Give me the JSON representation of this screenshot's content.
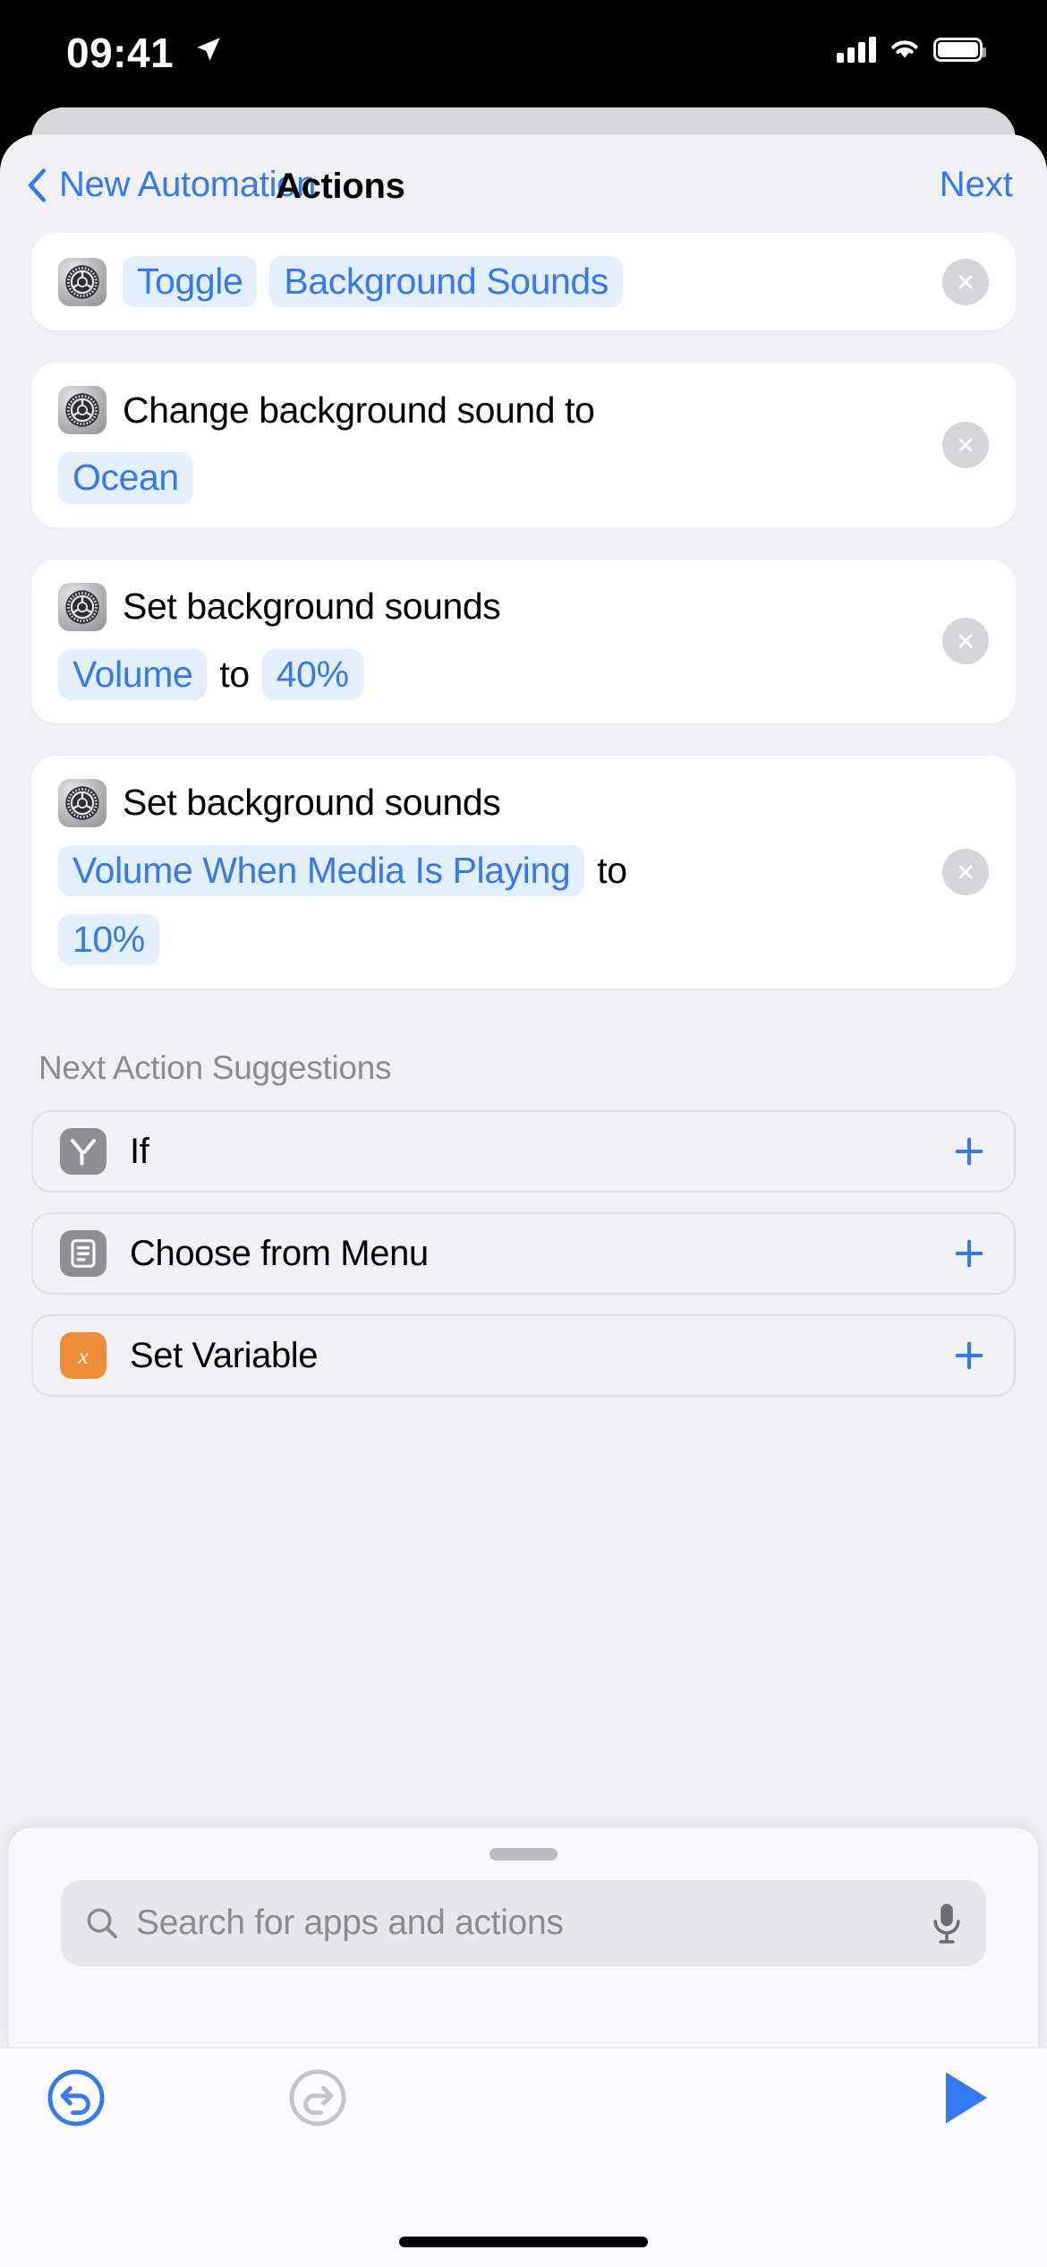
{
  "status_bar": {
    "time": "09:41",
    "location_icon": "location-arrow-icon",
    "cellular_icon": "cellular-bars-icon",
    "wifi_icon": "wifi-icon",
    "battery_icon": "battery-full-icon"
  },
  "nav": {
    "back_icon": "chevron-left-icon",
    "back_label": "New Automation",
    "title": "Actions",
    "next_label": "Next"
  },
  "colors": {
    "accent_blue": "#3478f6",
    "pill_background": "#e3effd",
    "sheet_background": "#f1f1f5",
    "card_background": "#ffffff",
    "orange_icon": "#ee8c3a",
    "gray_icon": "#8e8e93"
  },
  "actions": [
    {
      "app_icon": "settings-gear-icon",
      "remove_icon": "close-circle-icon",
      "tokens": [
        {
          "type": "pill",
          "text": "Toggle"
        },
        {
          "type": "pill",
          "text": "Background Sounds"
        }
      ]
    },
    {
      "app_icon": "settings-gear-icon",
      "remove_icon": "close-circle-icon",
      "tokens": [
        {
          "type": "text",
          "text": "Change background sound to"
        },
        {
          "type": "break"
        },
        {
          "type": "pill",
          "text": "Ocean"
        }
      ]
    },
    {
      "app_icon": "settings-gear-icon",
      "remove_icon": "close-circle-icon",
      "tokens": [
        {
          "type": "text",
          "text": "Set background sounds"
        },
        {
          "type": "break"
        },
        {
          "type": "pill",
          "text": "Volume"
        },
        {
          "type": "text",
          "text": "to"
        },
        {
          "type": "pill",
          "text": "40%"
        }
      ]
    },
    {
      "app_icon": "settings-gear-icon",
      "remove_icon": "close-circle-icon",
      "tokens": [
        {
          "type": "text",
          "text": "Set background sounds"
        },
        {
          "type": "break"
        },
        {
          "type": "pill",
          "text": "Volume When Media Is Playing"
        },
        {
          "type": "text",
          "text": "to"
        },
        {
          "type": "break"
        },
        {
          "type": "pill",
          "text": "10%"
        }
      ]
    }
  ],
  "suggestions": {
    "header": "Next Action Suggestions",
    "items": [
      {
        "label": "If",
        "icon": "branch-icon",
        "icon_style": "gray",
        "add_icon": "plus-icon"
      },
      {
        "label": "Choose from Menu",
        "icon": "menu-list-icon",
        "icon_style": "gray",
        "add_icon": "plus-icon"
      },
      {
        "label": "Set Variable",
        "icon": "variable-x-icon",
        "icon_style": "orange",
        "add_icon": "plus-icon"
      }
    ]
  },
  "drawer": {
    "grabber": "drawer-grabber",
    "search": {
      "placeholder": "Search for apps and actions",
      "value": "",
      "search_icon": "search-icon",
      "mic_icon": "microphone-icon"
    }
  },
  "toolbar": {
    "undo_icon": "undo-icon",
    "redo_icon": "redo-icon",
    "play_icon": "play-icon",
    "home_indicator": "home-indicator"
  }
}
